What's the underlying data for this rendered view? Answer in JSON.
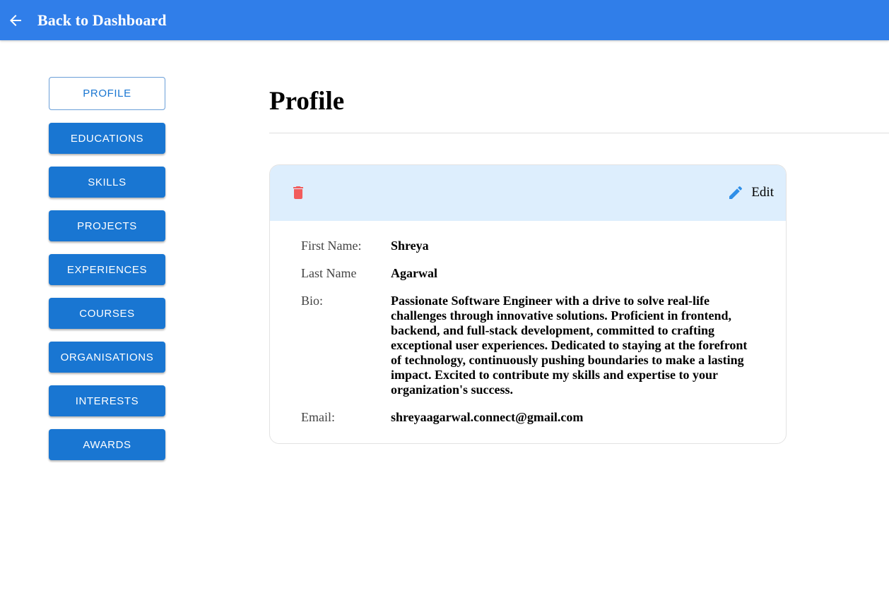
{
  "header": {
    "back_label": "Back to Dashboard",
    "background_color": "#307ee9"
  },
  "sidebar": {
    "items": [
      {
        "label": "PROFILE",
        "active": true
      },
      {
        "label": "EDUCATIONS",
        "active": false
      },
      {
        "label": "SKILLS",
        "active": false
      },
      {
        "label": "PROJECTS",
        "active": false
      },
      {
        "label": "EXPERIENCES",
        "active": false
      },
      {
        "label": "COURSES",
        "active": false
      },
      {
        "label": "ORGANISATIONS",
        "active": false
      },
      {
        "label": "INTERESTS",
        "active": false
      },
      {
        "label": "AWARDS",
        "active": false
      }
    ],
    "button_color": "#1976d2"
  },
  "main": {
    "title": "Profile",
    "card": {
      "edit_label": "Edit",
      "delete_icon": "trash-icon",
      "edit_icon": "pencil-icon",
      "delete_color": "#f25c5c",
      "edit_color": "#2f8fe8",
      "header_background": "#ddeefd",
      "fields": {
        "first_name": {
          "label": "First Name:",
          "value": "Shreya"
        },
        "last_name": {
          "label": "Last Name",
          "value": "Agarwal"
        },
        "bio": {
          "label": "Bio:",
          "value": "Passionate Software Engineer with a drive to solve real-life challenges through innovative solutions. Proficient in frontend, backend, and full-stack development, committed to crafting exceptional user experiences. Dedicated to staying at the forefront of technology, continuously pushing boundaries to make a lasting impact. Excited to contribute my skills and expertise to your organization's success."
        },
        "email": {
          "label": "Email:",
          "value": "shreyaagarwal.connect@gmail.com"
        }
      }
    }
  }
}
